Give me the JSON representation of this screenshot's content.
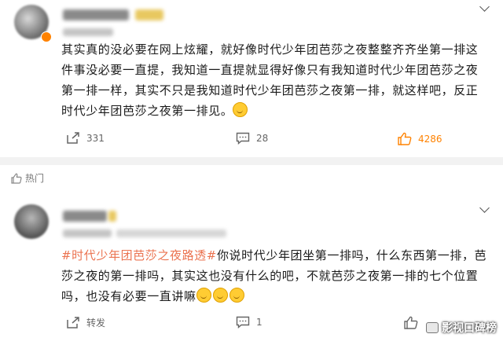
{
  "post1": {
    "text": "其实真的没必要在网上炫耀，就好像时代少年团芭莎之夜整整齐齐坐第一排这件事没必要一直提，我知道一直提就显得好像只有我知道时代少年团芭莎之夜第一排一样，其实不只是我知道时代少年团芭莎之夜第一排，就这样吧，反正时代少年团芭莎之夜第一排见。",
    "emoji": "smile-emoji",
    "repost_count": "331",
    "comment_count": "28",
    "like_count": "4286"
  },
  "section": {
    "hot_label": "热门"
  },
  "post2": {
    "hashtag": "#时代少年团芭莎之夜路透#",
    "text": "你说时代少年团坐第一排吗，什么东西第一排，芭莎之夜的第一排吗，其实这也没有什么的吧，不就芭莎之夜第一排的七个位置吗，也没有必要一直讲嘛",
    "emojis": [
      "smile-emoji",
      "smile-emoji",
      "smile-emoji"
    ],
    "repost_label": "转发",
    "comment_count": "1"
  },
  "watermark": {
    "text": "影视口碑榜"
  },
  "colors": {
    "accent": "#ff8200",
    "hashtag": "#eb7350",
    "divider": "#f2f2f2"
  }
}
